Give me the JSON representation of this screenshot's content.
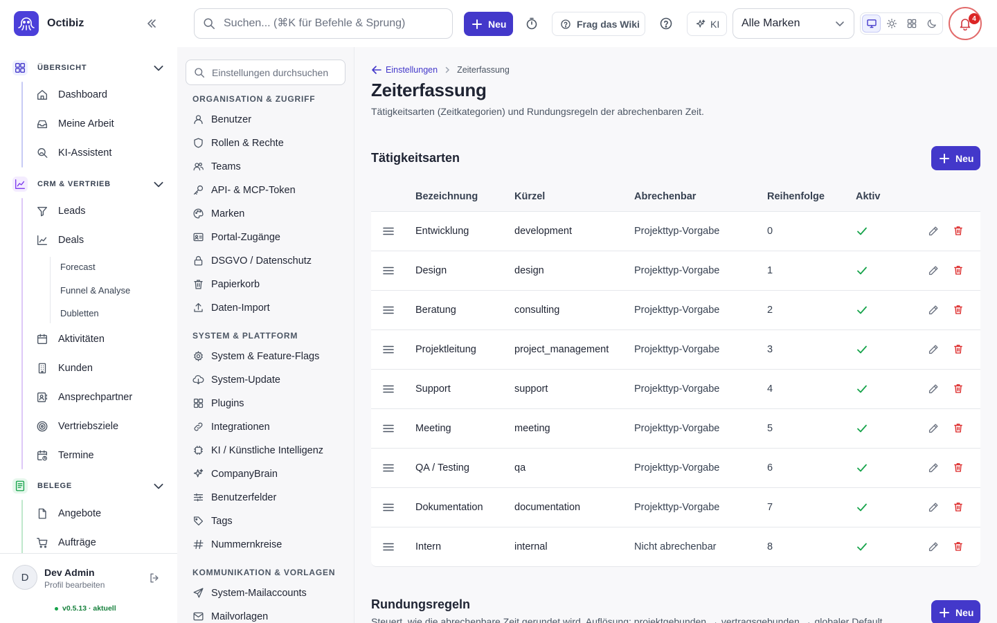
{
  "app": {
    "name": "Octibiz",
    "search_placeholder": "Suchen... (⌘K für Befehle & Sprung)",
    "new_label": "Neu",
    "wiki_label": "Frag das Wiki",
    "ki_label": "KI",
    "brand_select": "Alle Marken",
    "notification_count": "4",
    "accent_color": "#4338ca"
  },
  "sidebar": {
    "sections": [
      {
        "label": "ÜBERSICHT",
        "icon": "grid-icon",
        "items": [
          {
            "label": "Dashboard",
            "icon": "home-icon"
          },
          {
            "label": "Meine Arbeit",
            "icon": "inbox-icon"
          },
          {
            "label": "KI-Assistent",
            "icon": "search-person-icon"
          }
        ]
      },
      {
        "label": "CRM & VERTRIEB",
        "icon": "chart-line-icon",
        "items": [
          {
            "label": "Leads",
            "icon": "funnel-icon"
          },
          {
            "label": "Deals",
            "icon": "trend-icon"
          },
          {
            "label": "Aktivitäten",
            "icon": "calendar-icon"
          },
          {
            "label": "Kunden",
            "icon": "building-icon"
          },
          {
            "label": "Ansprechpartner",
            "icon": "contact-icon"
          },
          {
            "label": "Vertriebsziele",
            "icon": "target-icon"
          },
          {
            "label": "Termine",
            "icon": "calendar-clock-icon"
          }
        ],
        "deal_subitems": [
          "Forecast",
          "Funnel & Analyse",
          "Dubletten"
        ]
      },
      {
        "label": "BELEGE",
        "icon": "receipt-icon",
        "items": [
          {
            "label": "Angebote",
            "icon": "file-icon"
          },
          {
            "label": "Aufträge",
            "icon": "cart-icon"
          }
        ]
      }
    ],
    "user": {
      "initial": "D",
      "name": "Dev Admin",
      "sub": "Profil bearbeiten"
    },
    "version": "v0.5.13 · aktuell"
  },
  "settings": {
    "search_placeholder": "Einstellungen durchsuchen",
    "groups": [
      {
        "label": "ORGANISATION & ZUGRIFF",
        "items": [
          "Benutzer",
          "Rollen & Rechte",
          "Teams",
          "API- & MCP-Token",
          "Marken",
          "Portal-Zugänge",
          "DSGVO / Datenschutz",
          "Papierkorb",
          "Daten-Import"
        ]
      },
      {
        "label": "SYSTEM & PLATTFORM",
        "items": [
          "System & Feature-Flags",
          "System-Update",
          "Plugins",
          "Integrationen",
          "KI / Künstliche Intelligenz",
          "CompanyBrain",
          "Benutzerfelder",
          "Tags",
          "Nummernkreise"
        ]
      },
      {
        "label": "KOMMUNIKATION & VORLAGEN",
        "items": [
          "System-Mailaccounts",
          "Mailvorlagen"
        ]
      }
    ]
  },
  "page": {
    "breadcrumb_parent": "Einstellungen",
    "breadcrumb_current": "Zeiterfassung",
    "title": "Zeiterfassung",
    "description": "Tätigkeitsarten (Zeitkategorien) und Rundungsregeln der abrechenbaren Zeit.",
    "activity_section": {
      "title": "Tätigkeitsarten",
      "new_label": "Neu",
      "columns": [
        "Bezeichnung",
        "Kürzel",
        "Abrechenbar",
        "Reihenfolge",
        "Aktiv"
      ],
      "rows": [
        {
          "name": "Entwicklung",
          "code": "development",
          "billable": "Projekttyp-Vorgabe",
          "order": "0",
          "active": true
        },
        {
          "name": "Design",
          "code": "design",
          "billable": "Projekttyp-Vorgabe",
          "order": "1",
          "active": true
        },
        {
          "name": "Beratung",
          "code": "consulting",
          "billable": "Projekttyp-Vorgabe",
          "order": "2",
          "active": true
        },
        {
          "name": "Projektleitung",
          "code": "project_management",
          "billable": "Projekttyp-Vorgabe",
          "order": "3",
          "active": true
        },
        {
          "name": "Support",
          "code": "support",
          "billable": "Projekttyp-Vorgabe",
          "order": "4",
          "active": true
        },
        {
          "name": "Meeting",
          "code": "meeting",
          "billable": "Projekttyp-Vorgabe",
          "order": "5",
          "active": true
        },
        {
          "name": "QA / Testing",
          "code": "qa",
          "billable": "Projekttyp-Vorgabe",
          "order": "6",
          "active": true
        },
        {
          "name": "Dokumentation",
          "code": "documentation",
          "billable": "Projekttyp-Vorgabe",
          "order": "7",
          "active": true
        },
        {
          "name": "Intern",
          "code": "internal",
          "billable": "Nicht abrechenbar",
          "order": "8",
          "active": true
        }
      ]
    },
    "rounding_section": {
      "title": "Rundungsregeln",
      "new_label": "Neu",
      "description": "Steuert, wie die abrechenbare Zeit gerundet wird. Auflösung: projektgebunden → vertragsgebunden → globaler Default."
    }
  }
}
